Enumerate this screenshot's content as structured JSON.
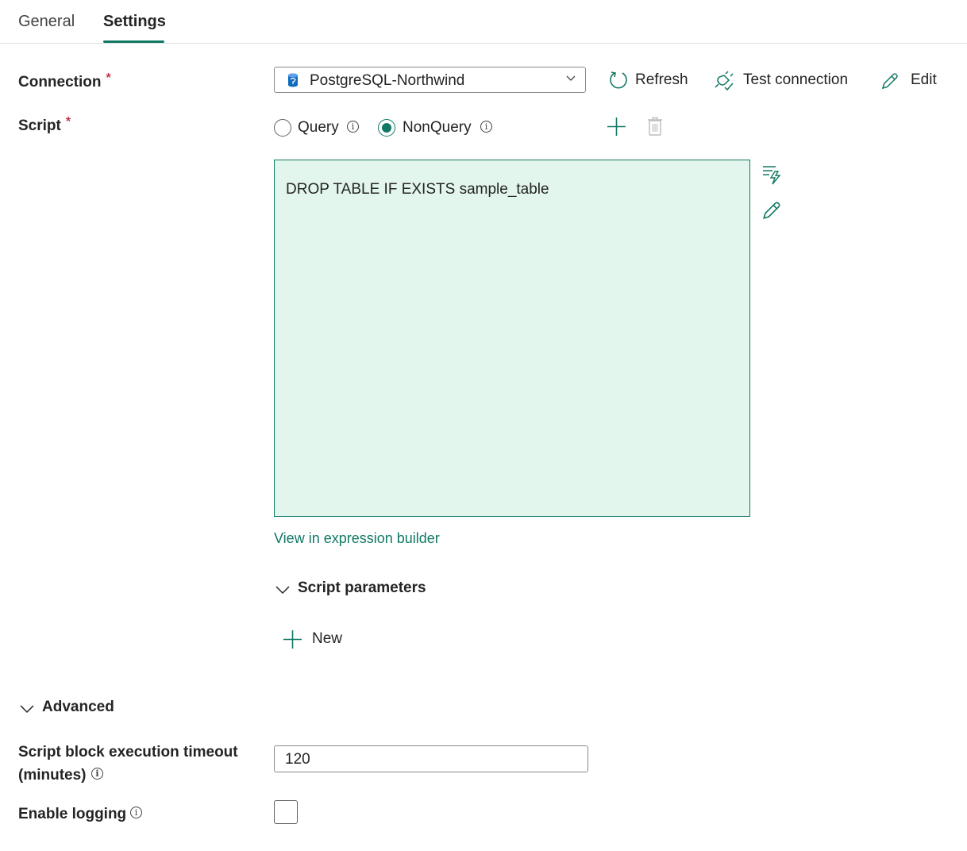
{
  "tabs": [
    {
      "label": "General",
      "active": false
    },
    {
      "label": "Settings",
      "active": true
    }
  ],
  "connection": {
    "label": "Connection",
    "required_mark": "*",
    "selected": "PostgreSQL-Northwind",
    "refresh_label": "Refresh",
    "test_label": "Test connection",
    "edit_label": "Edit"
  },
  "script": {
    "label": "Script",
    "required_mark": "*",
    "type_options": [
      {
        "label": "Query",
        "checked": false
      },
      {
        "label": "NonQuery",
        "checked": true
      }
    ],
    "content": "DROP TABLE IF EXISTS sample_table",
    "expression_link": "View in expression builder"
  },
  "script_parameters": {
    "label": "Script parameters",
    "new_label": "New"
  },
  "advanced": {
    "label": "Advanced",
    "timeout_label_line1": "Script block execution timeout",
    "timeout_label_line2": "(minutes)",
    "timeout_value": "120",
    "logging_label": "Enable logging",
    "logging_checked": false
  },
  "colors": {
    "accent": "#117865",
    "editor_bg": "#e3f6ed",
    "required": "#c4314b"
  }
}
